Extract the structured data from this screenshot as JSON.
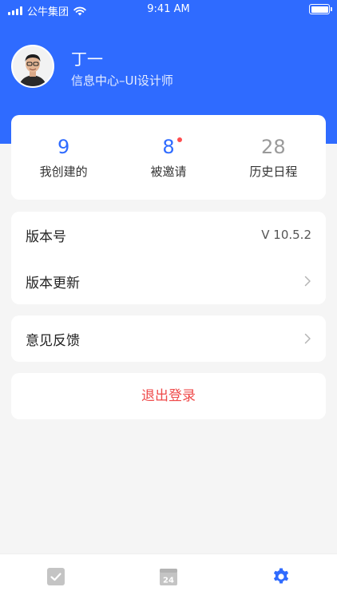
{
  "status_bar": {
    "carrier": "公牛集团",
    "time": "9:41 AM"
  },
  "profile": {
    "name": "丁一",
    "title": "信息中心–UI设计师"
  },
  "stats": [
    {
      "value": "9",
      "label": "我创建的",
      "color": "#2f6bff"
    },
    {
      "value": "8",
      "label": "被邀请",
      "color": "#2f6bff",
      "has_badge": true
    },
    {
      "value": "28",
      "label": "历史日程",
      "color": "#9a9a9a"
    }
  ],
  "settings": {
    "version_label": "版本号",
    "version_value": "V 10.5.2",
    "update_label": "版本更新",
    "feedback_label": "意见反馈",
    "logout_label": "退出登录"
  },
  "tab_bar": {
    "tabs": [
      {
        "icon": "checkbox-icon",
        "active": false
      },
      {
        "icon": "calendar-icon",
        "calendar_day": "24",
        "active": false
      },
      {
        "icon": "gear-icon",
        "active": true
      }
    ]
  },
  "colors": {
    "primary": "#2f6bff",
    "danger": "#ef4a4a",
    "inactive_icon": "#c4c4c4",
    "background": "#f5f5f5"
  }
}
